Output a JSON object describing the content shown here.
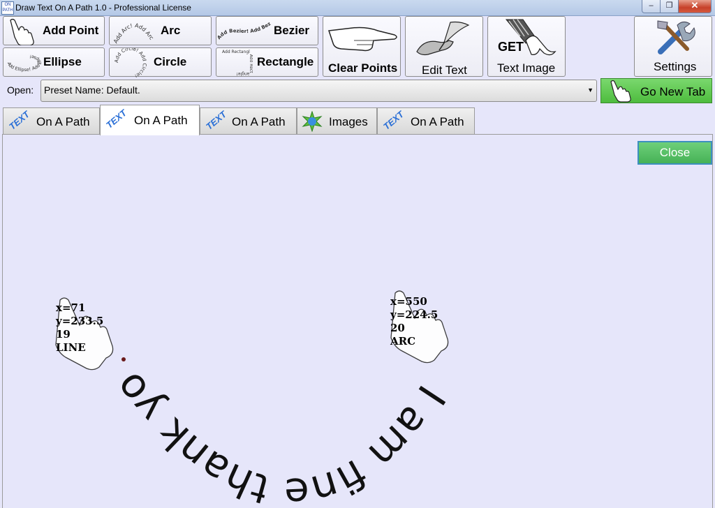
{
  "window": {
    "title": "Draw Text On A Path 1.0 - Professional License",
    "app_icon_text": "ON PATH"
  },
  "toolbar": {
    "add_point": "Add Point",
    "arc": "Arc",
    "arc_sample": "Add Arc! Add Arc",
    "bezier": "Bezier",
    "bezier_sample": "Add Bezier! Add Bezier!",
    "ellipse": "Ellipse",
    "ellipse_sample": "Add Ellipse! Add Ellipse!",
    "circle": "Circle",
    "circle_sample": "Add Circle! Add Circle!",
    "rectangle": "Rectangle",
    "rectangle_sample": "Add Rectangl Add Rectangle!",
    "clear_points": "Clear Points",
    "edit_text": "Edit Text",
    "text_image": "Text Image",
    "text_image_icon_text": "GET",
    "settings": "Settings"
  },
  "open_row": {
    "label": "Open:",
    "value": "Preset Name: Default.",
    "go_button": "Go New Tab"
  },
  "tabs": [
    {
      "label": "On A Path",
      "icon_text": "TEXT",
      "active": false
    },
    {
      "label": "On A Path",
      "icon_text": "TEXT",
      "active": true
    },
    {
      "label": "On A Path",
      "icon_text": "TEXT",
      "active": false
    },
    {
      "label": "Images",
      "icon": "star-image-icon",
      "active": false
    },
    {
      "label": "On A Path",
      "icon_text": "TEXT",
      "active": false
    }
  ],
  "canvas": {
    "close_button": "Close",
    "point1": {
      "line1": "x=71",
      "line2": "y=233.5",
      "line3": "19",
      "line4": "LINE"
    },
    "point2": {
      "line1": "x=550",
      "line2": "y=224.5",
      "line3": "20",
      "line4": "ARC"
    },
    "path_text": "I am fine thank you !"
  },
  "colors": {
    "background": "#e6e6fa",
    "go_button": "#56c247",
    "close_button": "#56c262",
    "tab_icon": "#2a6fd6"
  }
}
